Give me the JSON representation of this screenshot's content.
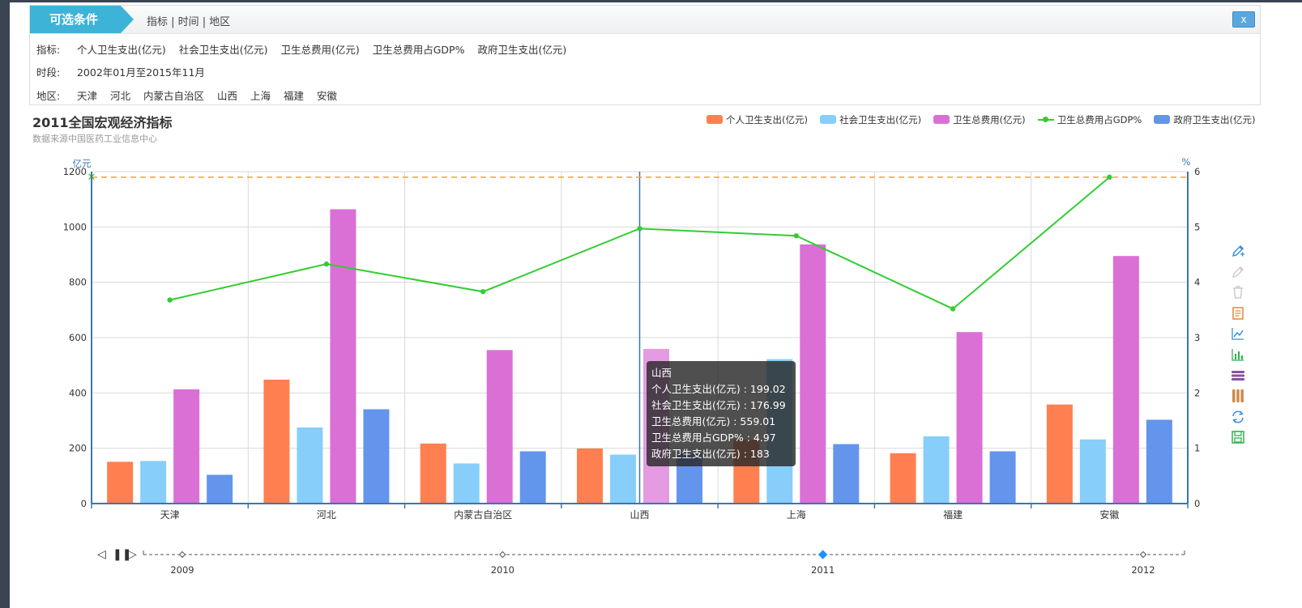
{
  "filter": {
    "title": "可选条件",
    "crumb": "指标 | 时间 | 地区",
    "close_label": "x",
    "indicators_label": "指标:",
    "indicators": [
      "个人卫生支出(亿元)",
      "社会卫生支出(亿元)",
      "卫生总费用(亿元)",
      "卫生总费用占GDP%",
      "政府卫生支出(亿元)"
    ],
    "period_label": "时段:",
    "period_value": "2002年01月至2015年11月",
    "region_label": "地区:",
    "regions": [
      "天津",
      "河北",
      "内蒙古自治区",
      "山西",
      "上海",
      "福建",
      "安徽"
    ]
  },
  "chart_data": {
    "type": "bar",
    "title": "2011全国宏观经济指标",
    "subtitle": "数据来源中国医药工业信息中心",
    "categories": [
      "天津",
      "河北",
      "内蒙古自治区",
      "山西",
      "上海",
      "福建",
      "安徽"
    ],
    "y_left": {
      "label": "亿元",
      "ticks": [
        0,
        200,
        400,
        600,
        800,
        1000,
        1200
      ],
      "min": 0,
      "max": 1200
    },
    "y_right": {
      "label": "%",
      "ticks": [
        0,
        1,
        2,
        3,
        4,
        5,
        6
      ],
      "min": 0,
      "max": 6
    },
    "series": [
      {
        "name": "个人卫生支出(亿元)",
        "type": "bar",
        "color": "#ff7f50",
        "values": [
          151,
          448,
          217,
          199.02,
          230,
          182,
          358
        ]
      },
      {
        "name": "社会卫生支出(亿元)",
        "type": "bar",
        "color": "#87cefa",
        "values": [
          154,
          275,
          145,
          176.99,
          522,
          243,
          232
        ]
      },
      {
        "name": "卫生总费用(亿元)",
        "type": "bar",
        "color": "#da70d6",
        "values": [
          413,
          1064,
          555,
          559.01,
          937,
          620,
          895
        ]
      },
      {
        "name": "卫生总费用占GDP%",
        "type": "line",
        "axis": "right",
        "color": "#32cd32",
        "values": [
          3.68,
          4.33,
          3.83,
          4.97,
          4.84,
          3.52,
          5.9
        ]
      },
      {
        "name": "政府卫生支出(亿元)",
        "type": "bar",
        "color": "#6495ed",
        "values": [
          104,
          341,
          189,
          183,
          215,
          189,
          303
        ]
      }
    ],
    "mark_line": {
      "axis": "right",
      "value": 5.9,
      "color": "#ffa022"
    },
    "highlight_index": 3,
    "legend_position": "top-right",
    "grid": true
  },
  "tooltip": {
    "title": "山西",
    "lines": [
      "个人卫生支出(亿元) : 199.02",
      "社会卫生支出(亿元) : 176.99",
      "卫生总费用(亿元) : 559.01",
      "卫生总费用占GDP% : 4.97",
      "政府卫生支出(亿元) : 183"
    ]
  },
  "toolbox": {
    "icons": [
      {
        "name": "mark-pen-icon",
        "color": "#3a8fd9"
      },
      {
        "name": "mark-undo-icon",
        "color": "#cccccc"
      },
      {
        "name": "mark-clear-icon",
        "color": "#cccccc"
      },
      {
        "name": "data-view-icon",
        "color": "#e08a3a"
      },
      {
        "name": "line-chart-icon",
        "color": "#3a8fd9"
      },
      {
        "name": "bar-chart-icon",
        "color": "#2fb34a"
      },
      {
        "name": "stack-icon",
        "color": "#8a4fa8"
      },
      {
        "name": "tiled-icon",
        "color": "#d08a4a"
      },
      {
        "name": "restore-icon",
        "color": "#3a8fd9"
      },
      {
        "name": "save-image-icon",
        "color": "#2fb34a"
      }
    ]
  },
  "timeline": {
    "years": [
      "2009",
      "2010",
      "2011",
      "2012"
    ],
    "current_index": 2
  }
}
